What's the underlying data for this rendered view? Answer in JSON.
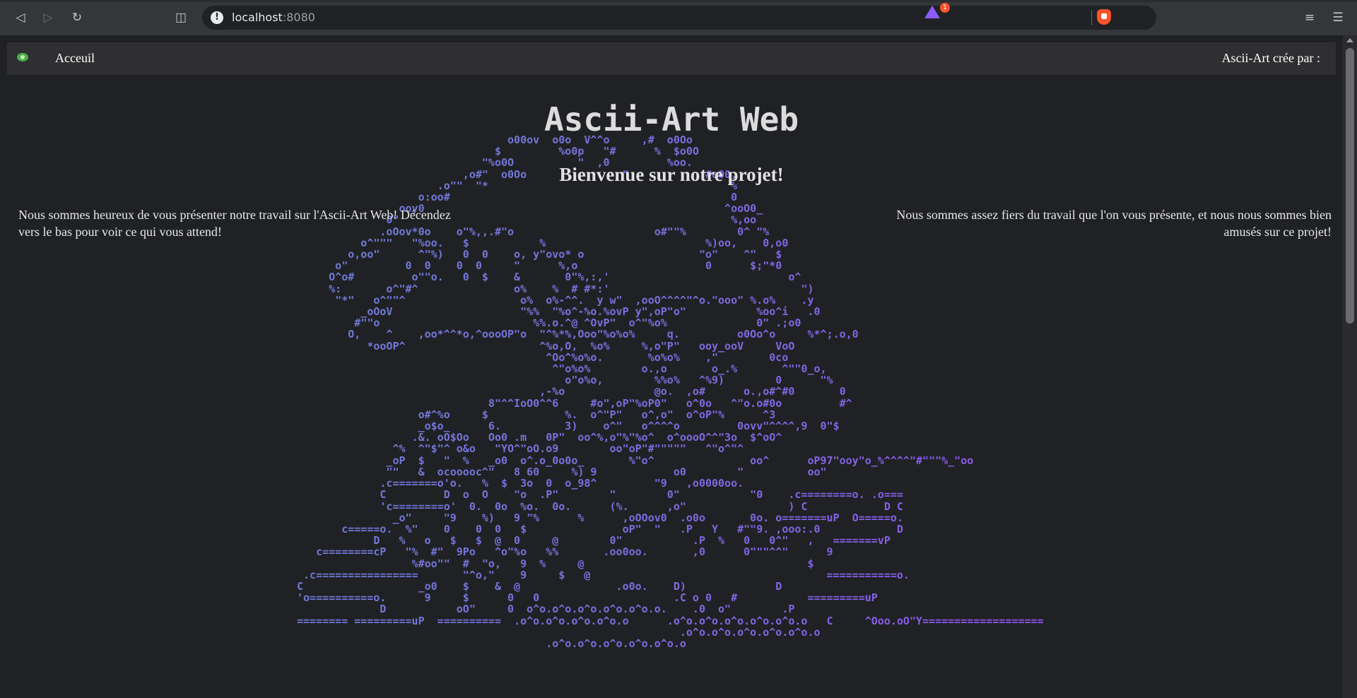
{
  "browser": {
    "url_host": "localhost",
    "url_port": ":8080",
    "rewards_badge": "1"
  },
  "nav": {
    "home_label": "Acceuil",
    "credit_label": "Ascii-Art crée par :"
  },
  "main": {
    "title": "Ascii-Art Web",
    "subtitle": "Bienvenue sur notre projet!",
    "intro_left": "Nous sommes heureux de vous présenter notre travail sur l'Ascii-Art Web! Décendez vers le bas pour voir ce qui vous attend!",
    "intro_right": "Nous sommes assez fiers du travail que l'on vous présente, et nous nous sommes bien amusés sur ce projet!"
  },
  "ascii_art": "                                 o00ov  o0o  V^^o     ,#  o0Oo\n                               $         %o0p   \"#      %  $o0O\n                             \"%o0O          \"  ,0         %oo.\n                          ,o#\"  o0Oo               \"            #oO0,\n                      .o\"\"  \"*                                      %\n                   o:oo#                                            0\n                ooy0                                               ^ooO0_\n              0\"                                                    %,oo\n             .oOov*0o    o\"%,,.#\"o                      o#\"\"%        0^ \"%\n          o^\"\"\"   \"%oo.   $           %                         %)oo,    0,o0\n        o,oo\"      ^\"%)   0  0    o, y\"ovo* o                  \"o\"    ^\"   $\n      o\"         0  0    0  0     \"      %,o                    0      $;\"*0\n     O^o#         o\"\"o.   0  $    &       0\"%,:,'                            o^\n     %:       o^\"#^               o%    %  # #*:'                              \")\n      \"*\"   o^\"\"^                  o%  o%-^^.  y w\"  ,ooO^^^^\"^o.\"ooo\" %.o%    .y\n          _oOoV                    \"%%  \"%o^-%o.%ovP y\",oP\"o\"           %oo^i   .0\n         #\"\"o                        %%.o.^@ ^OvP\"  o^\"%o%              0\" .;o0\n        O,    ^    ,oo*^^*o,^oooOP\"o  \"^%*%,Ooo\"%o%o%     q.         o0Oo^o     %*^;.o,0\n           *ooOP^                     ^%o,O,  %o%     %,o\"P\"   ooy_ooV     VoO\n                                       ^Oo^%o%o.       %o%o%    ,\"        0co\n                                        ^\"o%o%        o.,o       o_.%       ^\"\"0_o,\n                                          o\"o%o,        %%o%   ^%9)        0      \"%\n                                      ,-%o              @o.  ,o#      o.,o#^#0       0\n                              8\"^^IoO0^^6     #o\",oP\"%oP0\"   o^0o   ^\"o.o#0o         #^\n                   o#^%o     $            %.  o^\"P\"   o^,o\"  o^oP\"%      ^3\n                   _o$o_      6.          3)    o^\"   o^^^^o         0ovv\"^^^^,9  0\"$\n                  .&. oO$Oo   Oo0 .m   0P\"  oo^%,o\"%\"%o^  o^oooO^^\"3o  $^oO^\n               ^%  ^\"$\"^ o&o   \"YO^\"oO.o9        oo\"oP\"#\"\"\"\"\"   ^\"o^\"^\n              _oP  $   \"  %   _o0  o^.o_0o0o_       %\"o^               oo^      oP97\"ooy\"o_%^^^^\"#\"\"\"%_\"oo\n              \"\"   &  ocooooc^\"   8 60     %) 9            o0        \"          oo\"\n             .c=======o'o.   %  $  3o  0  o_98^         \"9   ,o0000oo.\n             C         D  o  O    \"o  .P\"        \"        0\"           \"0    .c========o. .o===\n             'c========o'  0.  0o  %o.  0o.      (%.      ,o\"                ) C            D C\n               _o\"     \"9    %)   9 \"%      %      ,oOOov0  .o0o       0o. o=======uP  O=====o.\n       c=====o.  %\"    0    0  0   $               oP\"  \"   .P   Y   #\"\"9. ,ooo:.0            D\n            D   %   o   $   $  @  0     @        0\"           .P  %   0   0^\"   ,   =======vP\n   c========cP   \"%  #\"  9Po   ^o\"%o   %%       .oo0oo.       ,0      0\"\"\"^^\"      9\n                  %#oo\"\"  #  \"o,   9  %     @                                   $\n .c================       \"^o,\"    9     $   @                                     ===========o.\nC                  _o0    $    &  @               .o0o.    D)              D\n'o==========o.      9     $      0   0                     .C o 0   #           =========uP\n             D           oO\"     0  o^o.o^o.o^o.o^o.o^o.o.    .0  o\"        .P\n======== =========uP  ==========  .o^o.o^o.o^o.o^o.o      .o^o.o^o.o^o.o^o.o^o.o   C     ^Ooo.oO\"Y===================\n                                                            .o^o.o^o.o^o.o^o.o^o.o\n                                       .o^o.o^o.o^o.o^o.o^o.o\n"
}
